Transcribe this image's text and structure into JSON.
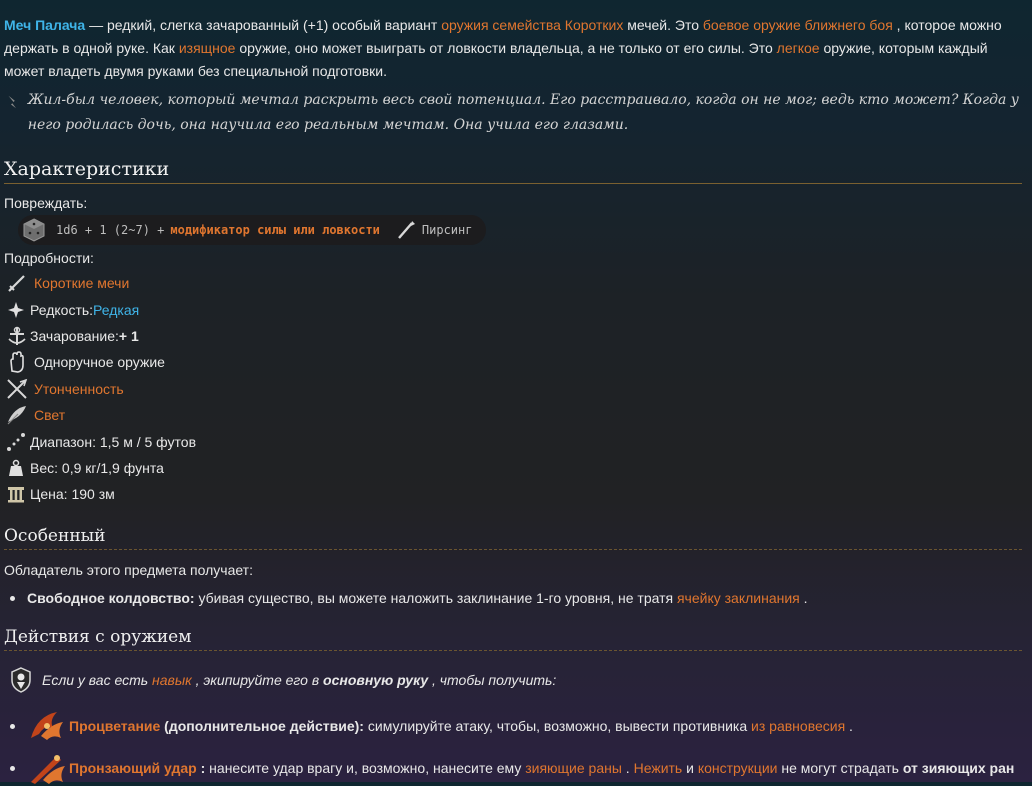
{
  "intro": {
    "name": "Меч Палача",
    "t1": " — редкий, слегка зачарованный (+1) особый вариант ",
    "l1": "оружия семейства Коротких",
    "t2": " мечей. Это ",
    "l2": "боевое оружие ближнего боя",
    "t3": " , которое можно держать в одной руке. Как ",
    "l3": "изящное",
    "t4": " оружие, оно может выиграть от ловкости владельца, а не только от его силы. Это ",
    "l4": "легкое",
    "t5": " оружие, которым каждый может владеть двумя руками без специальной подготовки."
  },
  "quote": "Жил-был человек, который мечтал раскрыть весь свой потенциал. Его расстраивало, когда он не мог; ведь кто может? Когда у него родилась дочь, она научила его реальным мечтам. Она учила его глазами.",
  "characteristics": {
    "heading": "Характеристики",
    "damage_label": "Повреждать:",
    "damage_roll": "1d6 + 1 (2~7) +",
    "damage_mod": "модификатор силы или ловкости",
    "damage_type": "Пирсинг",
    "details_label": "Подробности:",
    "details": {
      "type": "Короткие мечи",
      "rarity_label": "Редкость: ",
      "rarity_value": "Редкая",
      "enchant_label": "Зачарование: ",
      "enchant_value": "+ 1",
      "hand": "Одноручное оружие",
      "finesse": "Утонченность",
      "light": "Свет",
      "range": "Диапазон: 1,5 м / 5 футов",
      "weight": "Вес: 0,9 кг/1,9 фунта",
      "price": "Цена: 190 зм"
    }
  },
  "special": {
    "heading": "Особенный",
    "owner_text": "Обладатель этого предмета получает:",
    "bullet_bold": "Свободное колдовство:",
    "bullet_text": " убивая существо, вы можете наложить заклинание 1-го уровня, не тратя ",
    "bullet_link": "ячейку заклинания",
    "bullet_end": " ."
  },
  "actions": {
    "heading": "Действия с оружием",
    "equip_t1": "Если у вас есть ",
    "equip_link": "навык",
    "equip_t2": " , экипируйте его в ",
    "equip_bold": "основную руку",
    "equip_t3": " , чтобы получить:",
    "a1_name": "Процветание",
    "a1_bold": " (дополнительное действие):",
    "a1_text": " симулируйте атаку, чтобы, возможно, вывести противника ",
    "a1_link": "из равновесия",
    "a1_end": " .",
    "a2_name": "Пронзающий удар",
    "a2_bold": " :",
    "a2_text": " нанесите удар врагу и, возможно, нанесите ему ",
    "a2_link1": "зияющие раны",
    "a2_sep": " . ",
    "a2_link2": "Нежить",
    "a2_and": " и ",
    "a2_link3": "конструкции",
    "a2_text2": " не могут страдать ",
    "a2_bold2": "от зияющих ран"
  },
  "icons": {
    "quote": "quill-icon",
    "dice": "d6-dice-icon",
    "pierce": "piercing-icon",
    "sword": "short-sword-icon",
    "rarity": "sparkle-icon",
    "enchant": "enchantment-icon",
    "hand": "one-hand-icon",
    "finesse": "finesse-icon",
    "light": "feather-icon",
    "range": "range-icon",
    "weight": "weight-icon",
    "price": "price-icon",
    "proficiency": "proficiency-icon",
    "flourish": "flourish-icon",
    "pierce_strike": "piercing-strike-icon"
  },
  "colors": {
    "link": "#e0762f",
    "rare": "#3fb4e8",
    "name": "#3fb4e8"
  }
}
